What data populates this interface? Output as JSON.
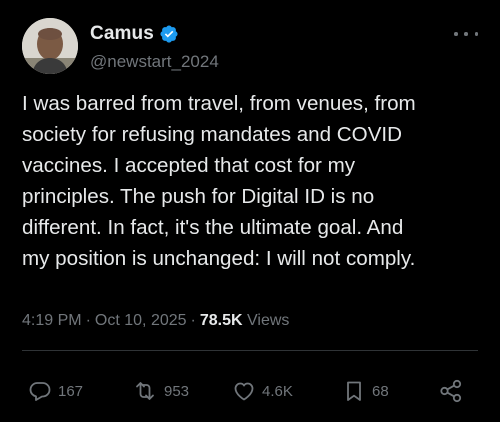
{
  "author": {
    "display_name": "Camus",
    "handle": "@newstart_2024",
    "verified": true
  },
  "post": {
    "lines": [
      "I was barred from travel, from venues, from",
      "society for refusing mandates and COVID",
      "vaccines. I accepted that cost for my",
      "principles. The push for Digital ID is no",
      "different. In fact, it's the ultimate goal. And",
      "my position is unchanged: I will not comply."
    ],
    "time": "4:19 PM",
    "date": "Oct 10, 2025",
    "views_count": "78.5K",
    "views_label": "Views"
  },
  "actions": {
    "replies": "167",
    "reposts": "953",
    "likes": "4.6K",
    "bookmarks": "68"
  },
  "colors": {
    "background": "#000000",
    "text": "#e7e9ea",
    "muted": "#71767b",
    "verified": "#1d9bf0",
    "divider": "#2f3336"
  },
  "icons": {
    "more": "more-icon",
    "reply": "reply-icon",
    "repost": "repost-icon",
    "like": "heart-icon",
    "bookmark": "bookmark-icon",
    "share": "share-icon",
    "verified": "verified-badge-icon"
  }
}
